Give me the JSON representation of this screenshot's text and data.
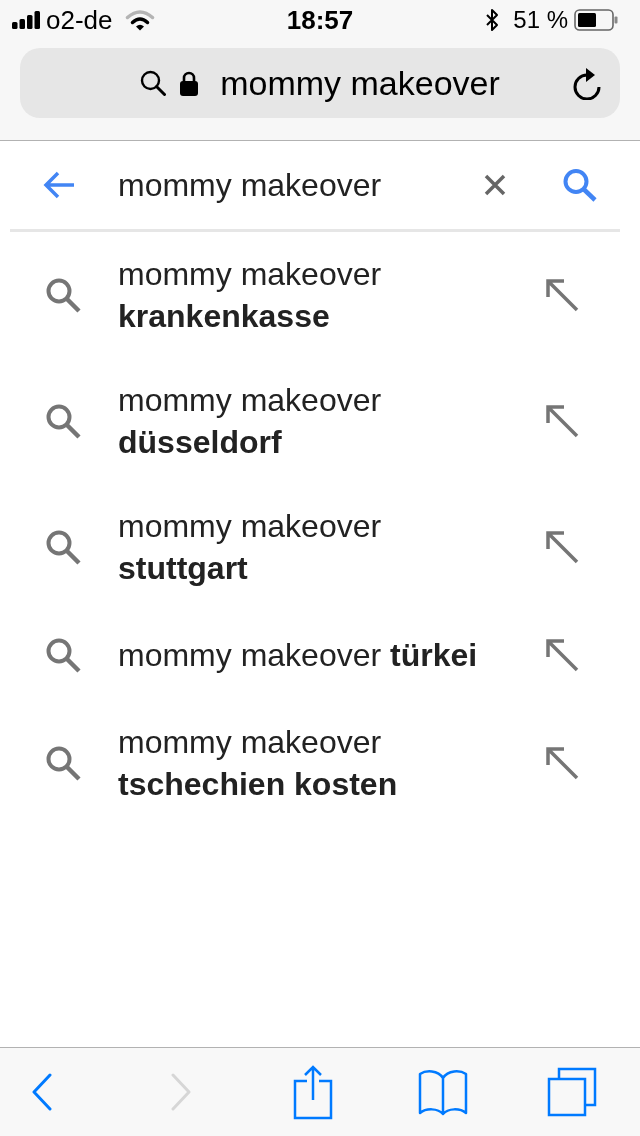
{
  "status_bar": {
    "carrier": "o2-de",
    "time": "18:57",
    "battery_text": "51 %"
  },
  "address_bar": {
    "text": "mommy makeover"
  },
  "search_box": {
    "value": "mommy makeover"
  },
  "suggestions": [
    {
      "text": "mommy makeover **krankenkasse**"
    },
    {
      "text": "mommy makeover **düsseldorf**"
    },
    {
      "text": "mommy makeover **stuttgart**"
    },
    {
      "text": "mommy makeover **türkei**"
    },
    {
      "text": "mommy makeover **tschechien kosten**"
    }
  ],
  "toolbar": [
    {
      "kind": "back",
      "disabled": false
    },
    {
      "kind": "forward",
      "disabled": true
    },
    {
      "kind": "share",
      "disabled": false
    },
    {
      "kind": "bookmarks",
      "disabled": false
    },
    {
      "kind": "tabs",
      "disabled": false
    }
  ]
}
